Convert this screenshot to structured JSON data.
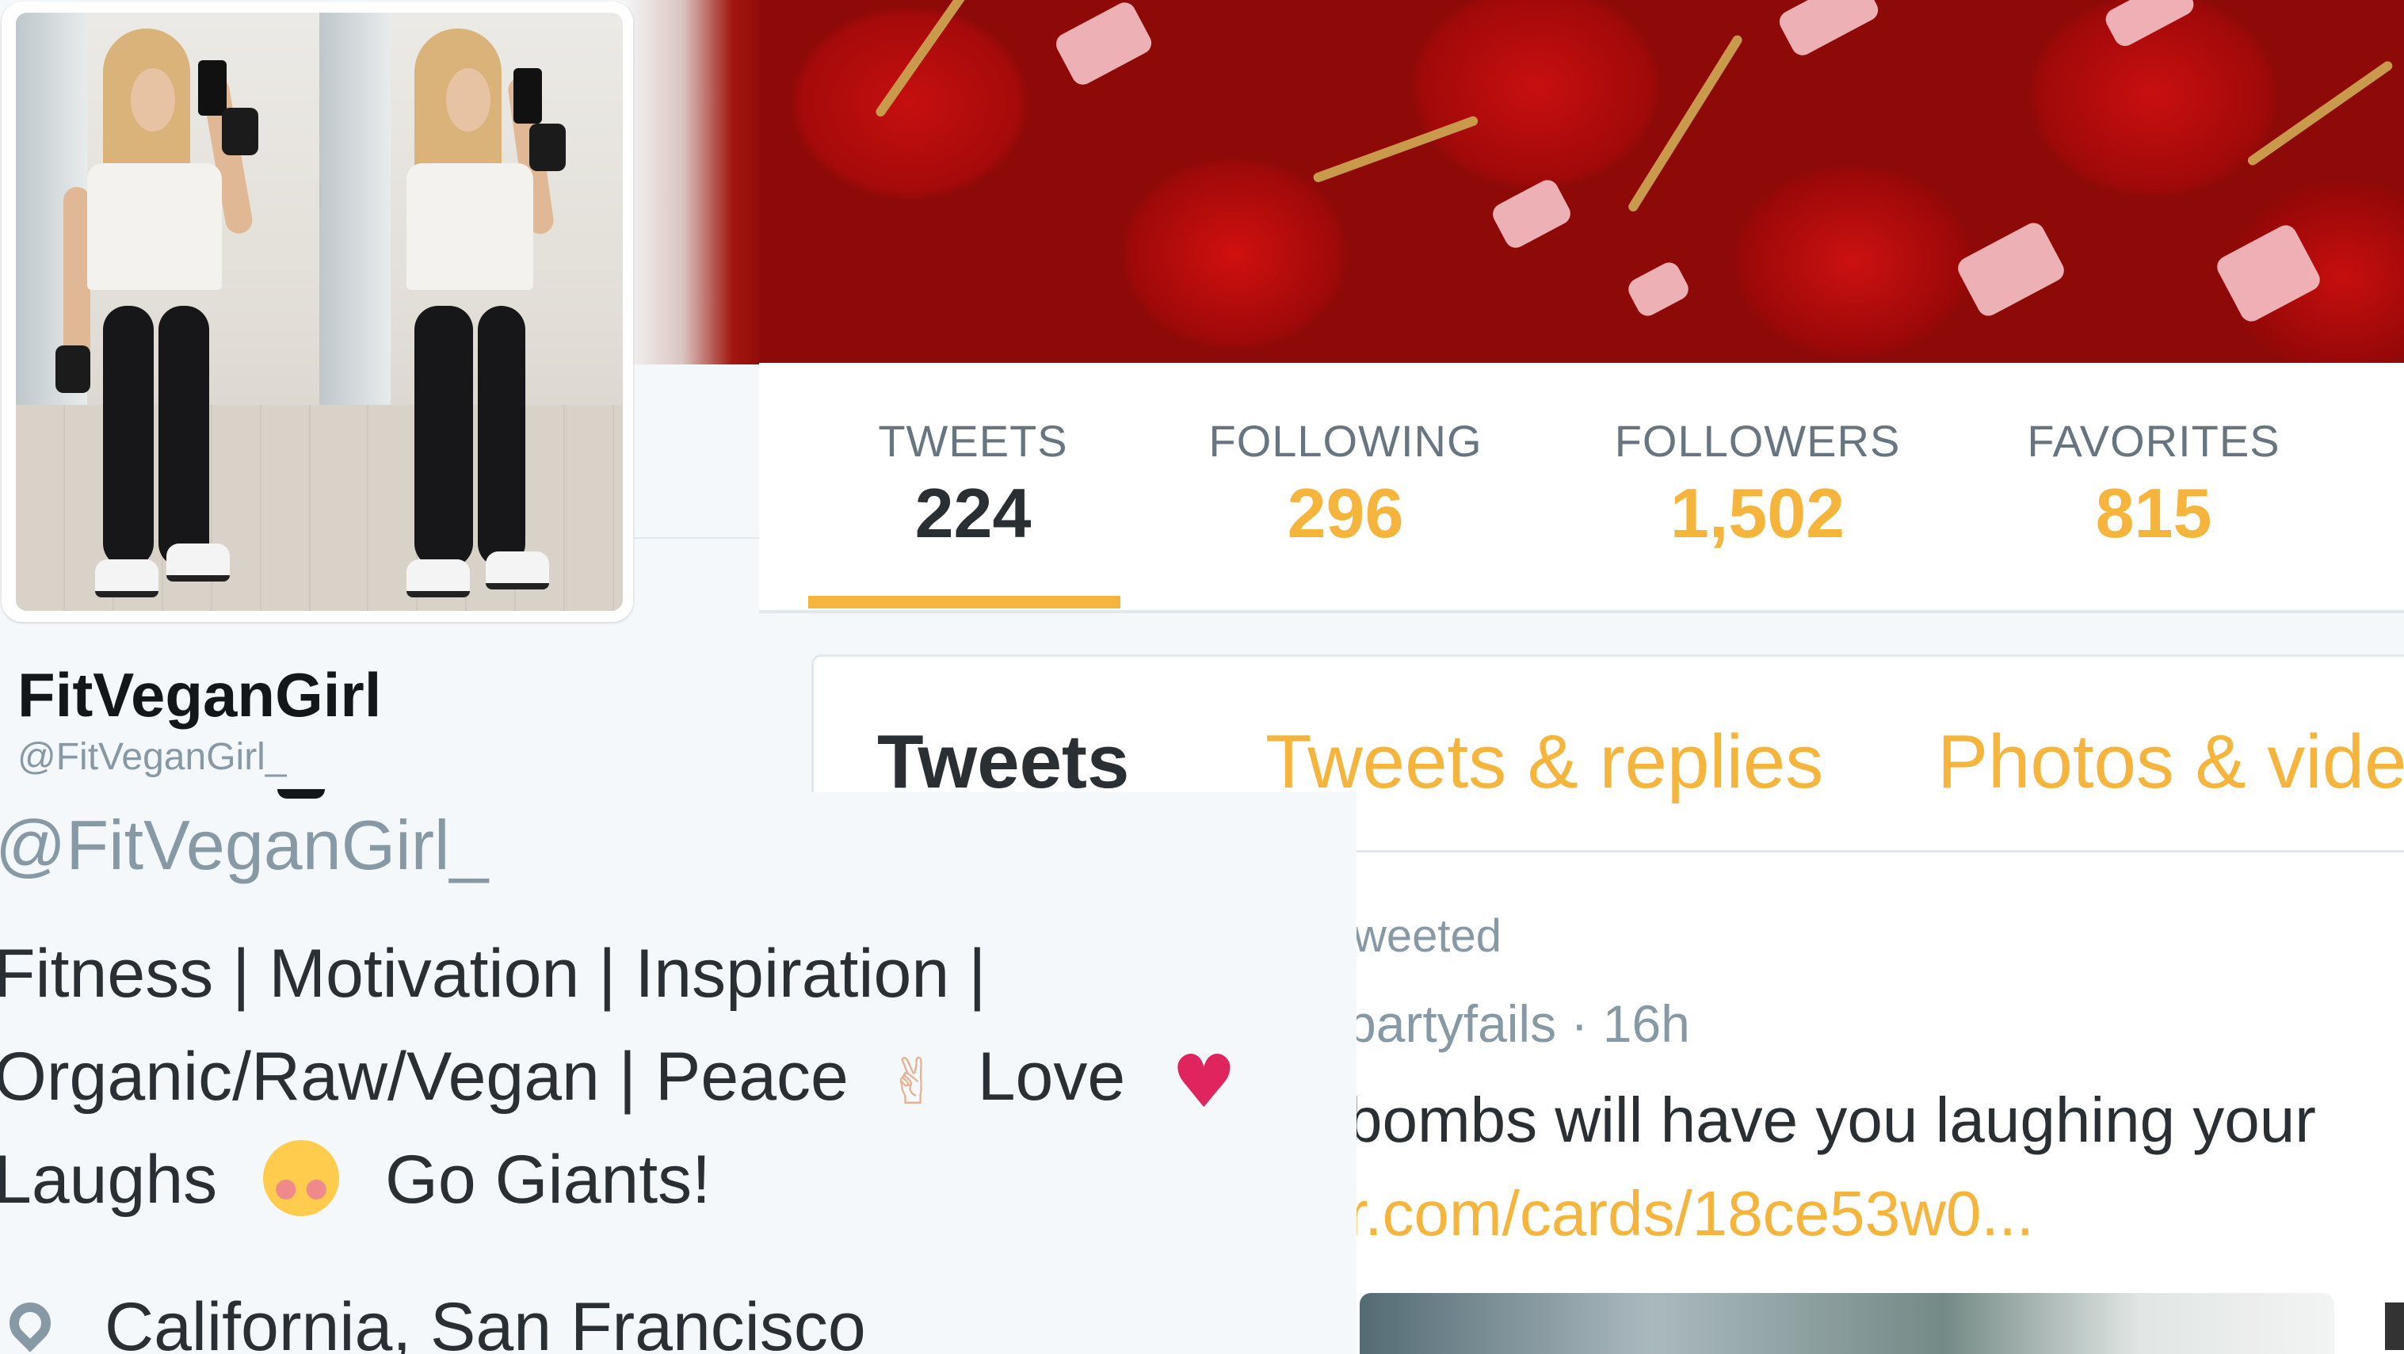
{
  "profile": {
    "name": "FitVeganGirl",
    "handle_small": "@FitVeganGirl_",
    "handle_large": "@FitVeganGirl_",
    "bio_line_1": "Fitness | Motivation | Inspiration |",
    "bio_line_2_text": "Organic/Raw/Vegan | Peace",
    "bio_line_2_peace_emoji": "✌",
    "bio_line_2_love": "Love",
    "bio_line_2_heart_emoji": "♥",
    "bio_line_3_laughs": "Laughs",
    "bio_line_3_tail": "Go Giants!",
    "location": "California, San Francisco"
  },
  "stats": [
    {
      "label": "TWEETS",
      "value": "224",
      "active": true
    },
    {
      "label": "FOLLOWING",
      "value": "296"
    },
    {
      "label": "FOLLOWERS",
      "value": "1,502"
    },
    {
      "label": "FAVORITES",
      "value": "815"
    }
  ],
  "timeline_tabs": [
    {
      "label": "Tweets",
      "active": true
    },
    {
      "label": "Tweets & replies"
    },
    {
      "label": "Photos & vide"
    }
  ],
  "tweet": {
    "retweeted": "weeted",
    "handle_time": "partyfails · 16h",
    "text": "bombs will have you laughing your",
    "link": "r.com/cards/18ce53w0..."
  },
  "colors": {
    "accent": "#f5b43b",
    "text_dark": "#292f33",
    "text_muted": "#8899a6",
    "divider": "#e1e8ed"
  },
  "icons": [
    "location-pin-icon",
    "peace-emoji-icon",
    "heart-emoji-icon",
    "smiling-face-emoji-icon"
  ]
}
